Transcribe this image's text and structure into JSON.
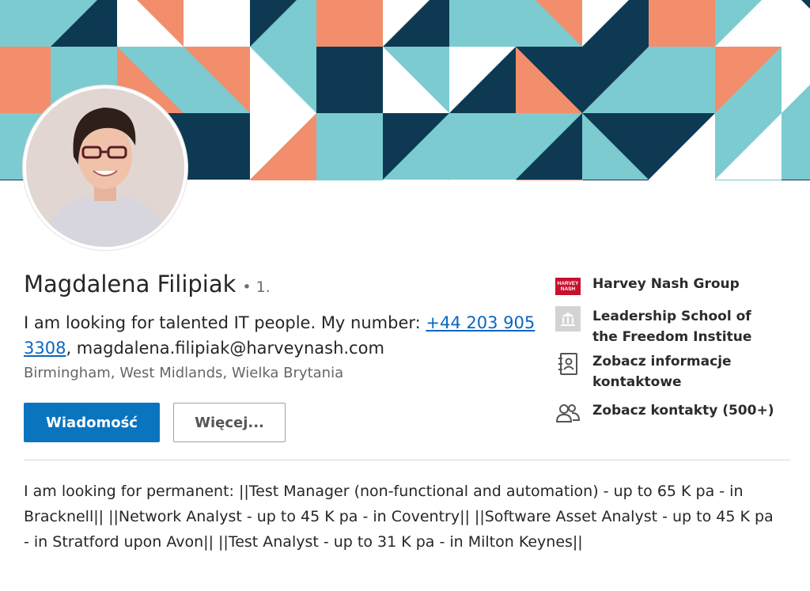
{
  "profile": {
    "name": "Magdalena Filipiak",
    "degree": "• 1.",
    "headline_prefix": "I am looking for talented IT people. My number: ",
    "phone": "+44 203 905 3308",
    "headline_suffix": ", magdalena.filipiak@harveynash.com",
    "location": "Birmingham, West Midlands, Wielka Brytania"
  },
  "actions": {
    "message_label": "Wiadomość",
    "more_label": "Więcej..."
  },
  "sidebar": {
    "company": {
      "label": "Harvey Nash Group",
      "logo_text": "HARVEY NASH",
      "icon": "company-logo"
    },
    "school": {
      "label": "Leadership School of the Freedom Institue",
      "icon": "school-icon"
    },
    "contact_info": {
      "label": "Zobacz informacje kontaktowe",
      "icon": "contact-card-icon"
    },
    "connections": {
      "label": "Zobacz kontakty (500+)",
      "icon": "people-icon"
    }
  },
  "summary": {
    "text": "I am looking for permanent: ||Test Manager (non-functional and automation) - up to 65 K pa - in Bracknell|| ||Network Analyst - up to 45 K pa - in Coventry|| ||Software Asset Analyst - up to 45 K pa - in Stratford upon Avon|| ||Test Analyst - up to 31 K pa - in Milton Keynes||"
  },
  "colors": {
    "primary_button": "#0a74bf",
    "link": "#0a66c2",
    "banner_navy": "#0d3a52",
    "banner_teal": "#7ccbd0",
    "banner_salmon": "#f28e6c",
    "banner_white": "#ffffff"
  }
}
